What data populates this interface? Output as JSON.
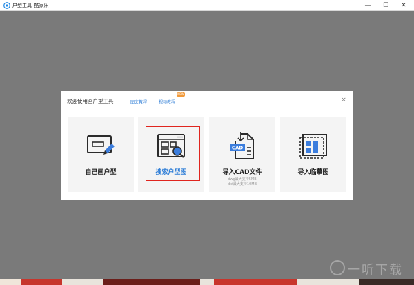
{
  "window": {
    "title": "户型工具_酷家乐",
    "minimize_glyph": "—",
    "maximize_glyph": "☐",
    "close_glyph": "✕"
  },
  "dialog": {
    "title": "欢迎使用画户型工具",
    "links": [
      "图文教程",
      "视频教程"
    ],
    "new_badge": "NEW",
    "close_glyph": "×"
  },
  "cards": [
    {
      "label": "自己画户型",
      "icon": "draw-floorplan-icon"
    },
    {
      "label": "搜索户型图",
      "icon": "search-floorplan-icon",
      "selected": true
    },
    {
      "label": "导入CAD文件",
      "icon": "cad-file-icon",
      "sub": [
        "dwg最大支持5MB",
        "dxf最大支持10MB"
      ]
    },
    {
      "label": "导入临摹图",
      "icon": "trace-image-icon"
    }
  ],
  "watermark": "一听下载",
  "colors": {
    "accent": "#2a7bd6",
    "highlight": "#e0251f",
    "overlay": "#7a7a7a",
    "card_bg": "#f4f4f4"
  }
}
